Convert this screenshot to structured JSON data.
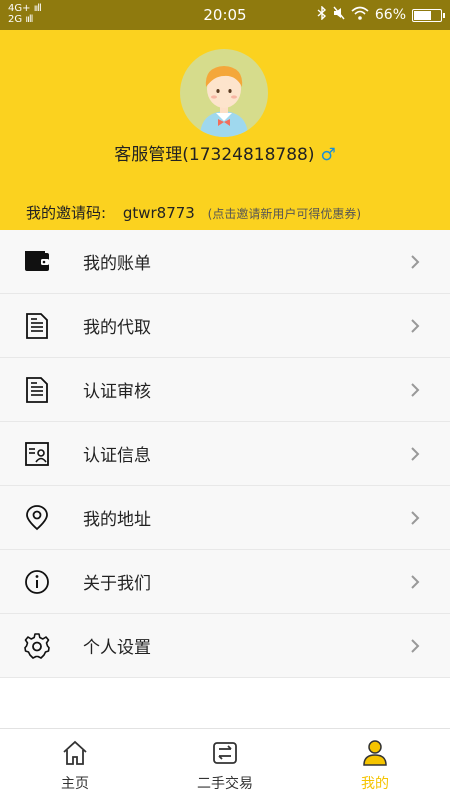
{
  "status_bar": {
    "network_top": "4G+",
    "network_bottom": "2G",
    "time": "20:05",
    "battery": "66%",
    "battery_level": 0.66
  },
  "profile": {
    "name_phone": "客服管理(17324818788)",
    "gender_symbol": "♂",
    "invite_label": "我的邀请码:",
    "invite_code": "gtwr8773",
    "invite_hint": "(点击邀请新用户可得优惠券)"
  },
  "menu": {
    "items": [
      {
        "label": "我的账单",
        "icon": "wallet-icon"
      },
      {
        "label": "我的代取",
        "icon": "document-icon"
      },
      {
        "label": "认证审核",
        "icon": "document-icon"
      },
      {
        "label": "认证信息",
        "icon": "id-card-icon"
      },
      {
        "label": "我的地址",
        "icon": "location-pin-icon"
      },
      {
        "label": "关于我们",
        "icon": "info-icon"
      },
      {
        "label": "个人设置",
        "icon": "gear-icon"
      }
    ]
  },
  "tabbar": {
    "tabs": [
      {
        "label": "主页",
        "icon": "home-icon"
      },
      {
        "label": "二手交易",
        "icon": "trade-icon"
      },
      {
        "label": "我的",
        "icon": "user-icon",
        "active": true
      }
    ]
  },
  "colors": {
    "header_bg": "#fbd21f",
    "status_bg": "#8f7a0e",
    "active_tab": "#f5c400"
  }
}
